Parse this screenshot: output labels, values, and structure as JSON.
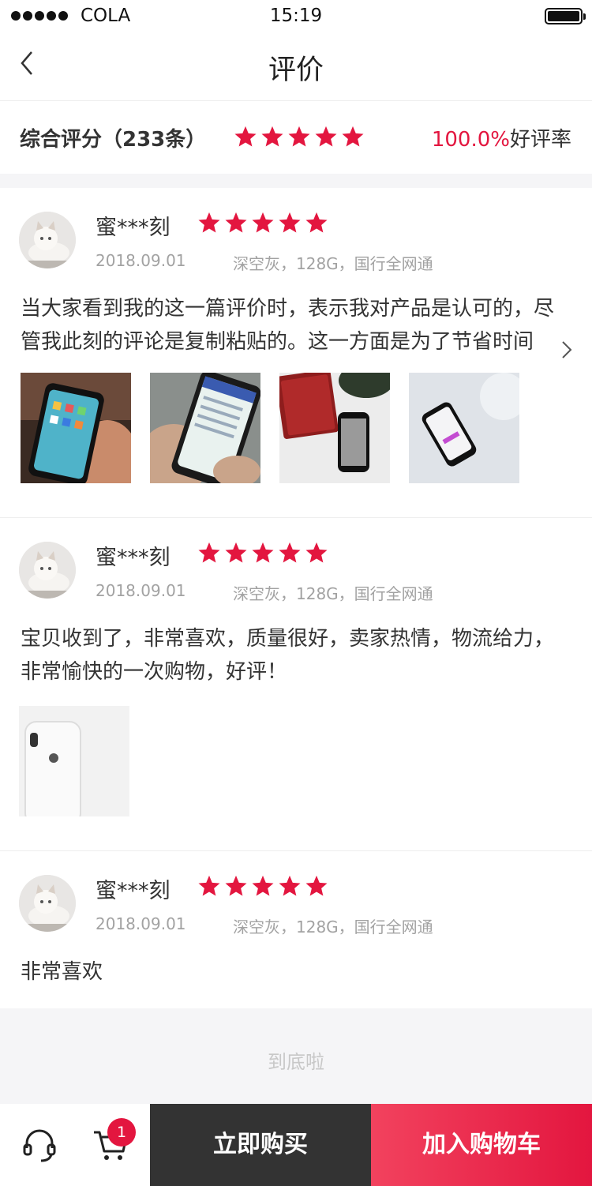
{
  "status_bar": {
    "carrier": "COLA",
    "time": "15:19"
  },
  "nav": {
    "title": "评价",
    "back_icon": "chevron-left-icon"
  },
  "summary": {
    "label": "综合评分（233条）",
    "rating": 5,
    "rate_percent": "100.0%",
    "rate_suffix": "好评率"
  },
  "colors": {
    "accent": "#e3163f",
    "dark_button": "#333333",
    "muted_text": "#a2a2a2",
    "band": "#f5f5f7"
  },
  "reviews": [
    {
      "user": "蜜***刻",
      "rating": 5,
      "date": "2018.09.01",
      "sku": "深空灰，128G，国行全网通",
      "text": "当大家看到我的这一篇评价时，表示我对产品是认可的，尽管我此刻的评论是复制粘贴的。这一方面是为了节省时间",
      "photos": [
        "phone-in-hand-photo",
        "phone-app-photo",
        "phone-on-desk-photo",
        "phone-on-table-photo"
      ]
    },
    {
      "user": "蜜***刻",
      "rating": 5,
      "date": "2018.09.01",
      "sku": "深空灰，128G，国行全网通",
      "text": "宝贝收到了，非常喜欢，质量很好，卖家热情，物流给力，非常愉快的一次购物，好评！",
      "photos": [
        "white-iphone-back-photo"
      ]
    },
    {
      "user": "蜜***刻",
      "rating": 5,
      "date": "2018.09.01",
      "sku": "深空灰，128G，国行全网通",
      "text": "非常喜欢",
      "photos": []
    }
  ],
  "end_text": "到底啦",
  "bottom_bar": {
    "service_icon": "headset-icon",
    "cart_icon": "cart-icon",
    "cart_count": "1",
    "buy_label": "立即购买",
    "add_cart_label": "加入购物车"
  }
}
